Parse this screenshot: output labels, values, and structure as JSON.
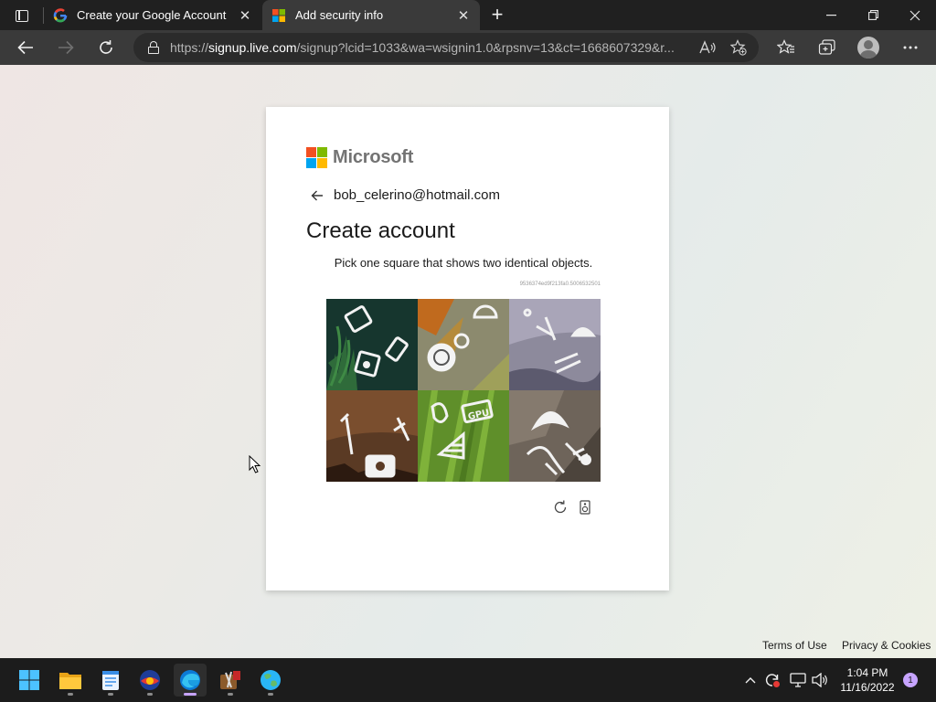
{
  "browser": {
    "tabs": [
      {
        "label": "Create your Google Account",
        "favicon": "google-icon",
        "active": false
      },
      {
        "label": "Add security info",
        "favicon": "microsoft-icon",
        "active": true
      }
    ],
    "url": {
      "scheme": "https://",
      "host": "signup.live.com",
      "path": "/signup?lcid=1033&wa=wsignin1.0&rpsnv=13&ct=1668607329&r..."
    }
  },
  "card": {
    "brand": "Microsoft",
    "identity": "bob_celerino@hotmail.com",
    "title": "Create account",
    "captcha": {
      "prompt": "Pick one square that shows two identical objects.",
      "id": "9536374ed9f213fa0.5006532501",
      "tiles": [
        {
          "name": "captcha-tile-1"
        },
        {
          "name": "captcha-tile-2"
        },
        {
          "name": "captcha-tile-3"
        },
        {
          "name": "captcha-tile-4"
        },
        {
          "name": "captcha-tile-5",
          "label": "GPU"
        },
        {
          "name": "captcha-tile-6"
        }
      ]
    }
  },
  "footer": {
    "terms": "Terms of Use",
    "privacy": "Privacy & Cookies"
  },
  "taskbar": {
    "time": "1:04 PM",
    "date": "11/16/2022",
    "notifications": "1"
  },
  "colors": {
    "ms_red": "#f25022",
    "ms_green": "#7fba00",
    "ms_blue": "#00a4ef",
    "ms_yellow": "#ffb900",
    "accent": "#c7a4ff"
  }
}
